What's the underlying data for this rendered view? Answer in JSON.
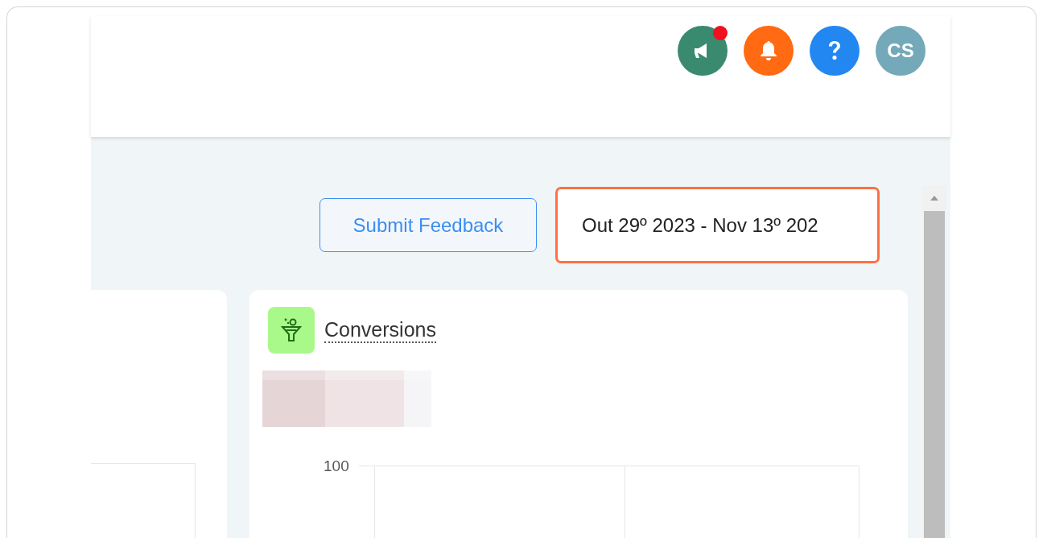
{
  "header": {
    "actions": [
      {
        "kind": "announcements",
        "unread": true
      },
      {
        "kind": "notifications",
        "unread": false
      },
      {
        "kind": "help",
        "unread": false
      }
    ],
    "avatar": {
      "initials": "CS"
    }
  },
  "toolbar": {
    "feedback_button": "Submit Feedback",
    "date_range": {
      "value": "Out 29º 2023 - Nov 13º 202",
      "focused": true
    }
  },
  "cards": [
    {
      "kind": "partial"
    },
    {
      "kind": "chart",
      "title": "Conversions",
      "y_tick": "100"
    }
  ]
}
